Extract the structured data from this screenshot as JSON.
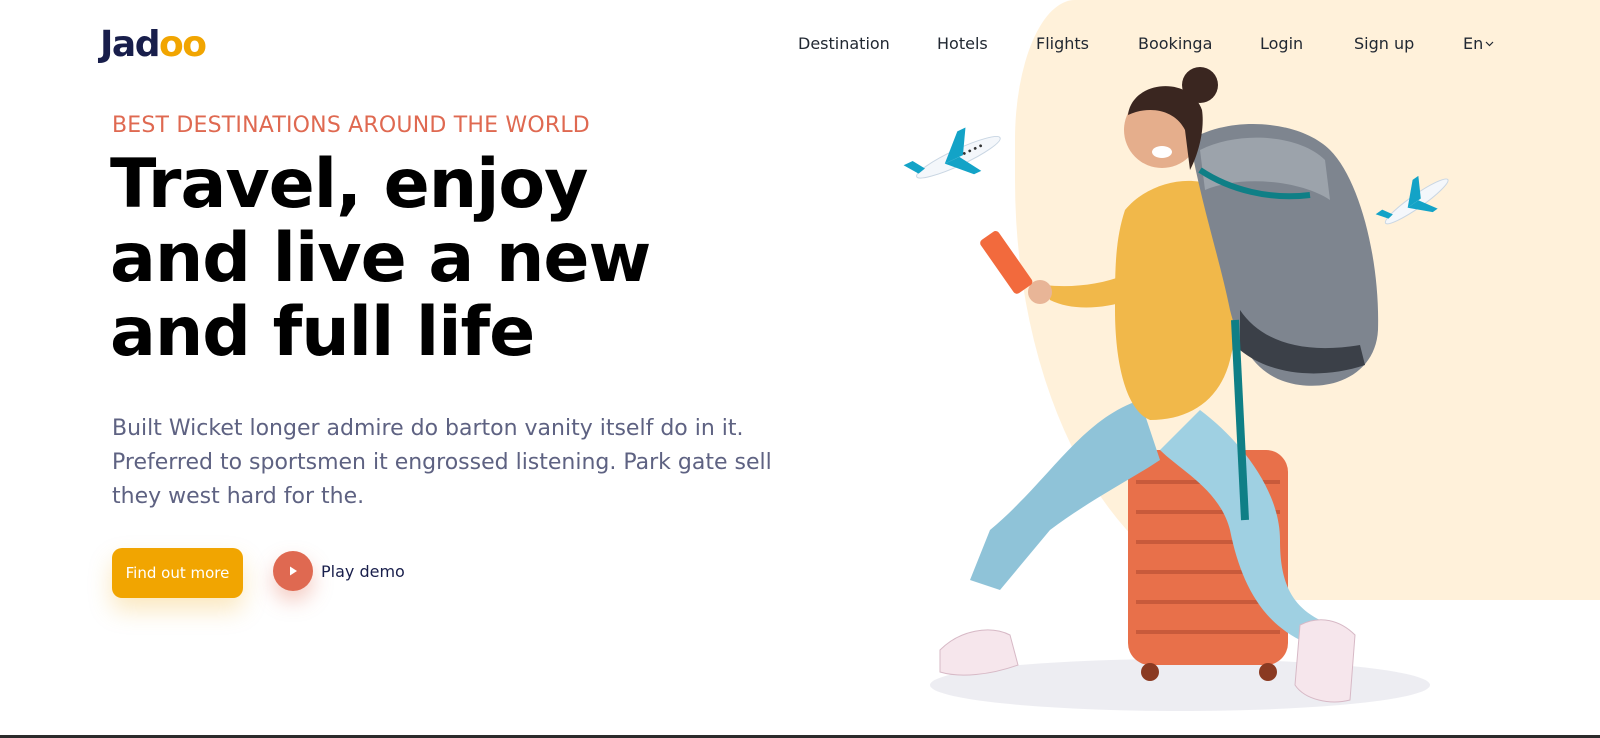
{
  "brand": {
    "name_prefix": "Jad",
    "name_suffix": "oo",
    "accent_color": "#f1a501",
    "secondary_color": "#df6951"
  },
  "nav": {
    "items": [
      "Destination",
      "Hotels",
      "Flights",
      "Bookinga",
      "Login",
      "Sign up"
    ],
    "language": "En",
    "language_icon": "chevron-down-icon"
  },
  "hero": {
    "eyebrow": "BEST DESTINATIONS AROUND THE WORLD",
    "headline_lines": [
      "Travel, enjoy",
      "and live a new",
      "and full life"
    ],
    "description_lines": [
      "Built Wicket longer admire do barton vanity itself do in it.",
      "Preferred to sportsmen it engrossed listening. Park gate sell",
      "they west hard for the."
    ],
    "cta_label": "Find out more",
    "play_label": "Play demo",
    "play_icon": "play-icon"
  },
  "illustration": {
    "subject": "traveler-with-backpack-on-suitcase",
    "decorations": [
      "airplane-icon",
      "airplane-icon"
    ]
  }
}
